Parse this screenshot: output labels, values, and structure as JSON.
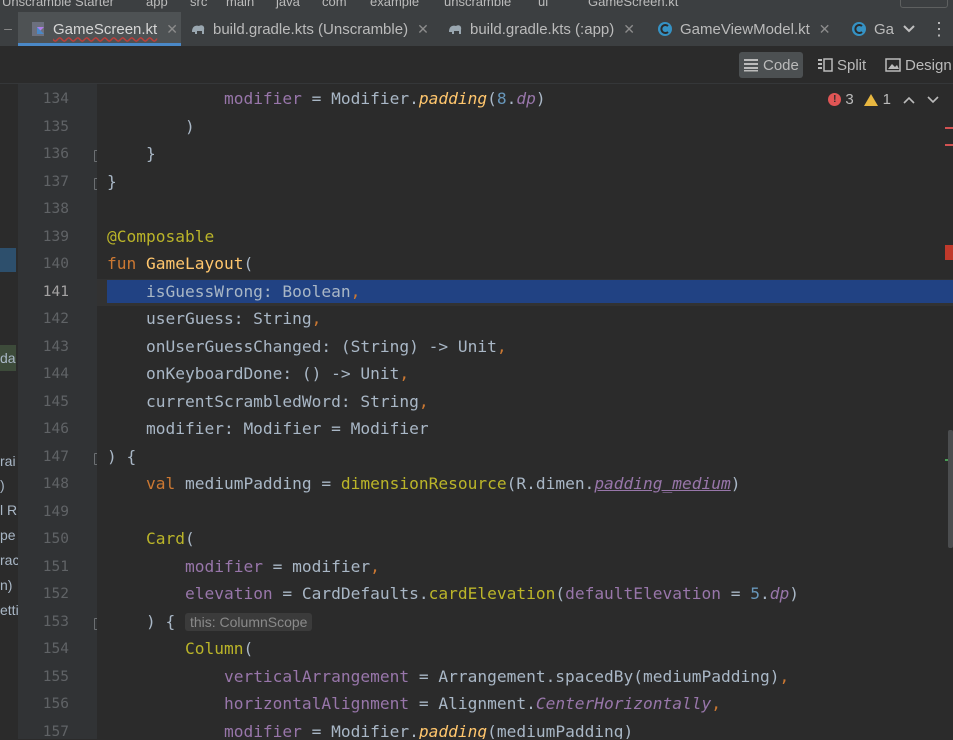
{
  "breadcrumb": [
    "Unscramble Starter",
    "app",
    "src",
    "main",
    "java",
    "com",
    "example",
    "unscramble",
    "ui",
    "GameScreen.kt"
  ],
  "tabs": [
    {
      "label": "GameScreen.kt",
      "icon": "kotlin-file-icon",
      "active": true
    },
    {
      "label": "build.gradle.kts (Unscramble)",
      "icon": "gradle-elephant-icon",
      "active": false
    },
    {
      "label": "build.gradle.kts (:app)",
      "icon": "gradle-elephant-icon",
      "active": false
    },
    {
      "label": "GameViewModel.kt",
      "icon": "kotlin-class-icon",
      "active": false
    },
    {
      "label": "Ga",
      "icon": "kotlin-class-icon",
      "active": false
    }
  ],
  "toolbar": {
    "code_label": "Code",
    "split_label": "Split",
    "design_label": "Design"
  },
  "inspections": {
    "errors": "3",
    "warnings": "1"
  },
  "left_panel_fragments": [
    "da",
    "rai",
    ")",
    "l R",
    "pe",
    "rac",
    "n)",
    "etti"
  ],
  "line_numbers": [
    "134",
    "135",
    "136",
    "137",
    "138",
    "139",
    "140",
    "141",
    "142",
    "143",
    "144",
    "145",
    "146",
    "147",
    "148",
    "149",
    "150",
    "151",
    "152",
    "153",
    "154",
    "155",
    "156",
    "157"
  ],
  "current_line": "141",
  "inlay_hint": "this: ColumnScope",
  "colors": {
    "editor_bg": "#2b2b2b",
    "gutter_bg": "#313335",
    "selection": "#214283",
    "keyword": "#cc7832",
    "function": "#ffc66d",
    "annotation": "#bbb529",
    "property": "#9876aa",
    "number": "#6897bb",
    "text": "#a9b7c6"
  },
  "code_lines": [
    [
      {
        "t": "            "
      },
      {
        "t": "modifier",
        "c": "pr"
      },
      {
        "t": " = Modifier."
      },
      {
        "t": "padding",
        "c": "fn it"
      },
      {
        "t": "("
      },
      {
        "t": "8",
        "c": "nm"
      },
      {
        "t": "."
      },
      {
        "t": "dp",
        "c": "pr it"
      },
      {
        "t": ")"
      }
    ],
    [
      {
        "t": "        )"
      }
    ],
    [
      {
        "t": "    }"
      }
    ],
    [
      {
        "t": "}"
      }
    ],
    [
      {
        "t": ""
      }
    ],
    [
      {
        "t": "@Composable",
        "c": "an"
      }
    ],
    [
      {
        "t": "fun ",
        "c": "kw"
      },
      {
        "t": "GameLayout",
        "c": "fn"
      },
      {
        "t": "("
      }
    ],
    [
      {
        "t": "    isGuessWrong: Boolean"
      },
      {
        "t": ",",
        "c": "kw"
      }
    ],
    [
      {
        "t": "    userGuess: String"
      },
      {
        "t": ",",
        "c": "kw"
      }
    ],
    [
      {
        "t": "    onUserGuessChanged: (String) -> Unit"
      },
      {
        "t": ",",
        "c": "kw"
      }
    ],
    [
      {
        "t": "    onKeyboardDone: () -> Unit"
      },
      {
        "t": ",",
        "c": "kw"
      }
    ],
    [
      {
        "t": "    currentScrambledWord: String"
      },
      {
        "t": ",",
        "c": "kw"
      }
    ],
    [
      {
        "t": "    modifier: Modifier = Modifier"
      }
    ],
    [
      {
        "t": ") {"
      }
    ],
    [
      {
        "t": "    "
      },
      {
        "t": "val ",
        "c": "kw"
      },
      {
        "t": "mediumPadding = "
      },
      {
        "t": "dimensionResource",
        "c": "an"
      },
      {
        "t": "(R.dimen."
      },
      {
        "t": "padding_medium",
        "c": "pr it ul"
      },
      {
        "t": ")"
      }
    ],
    [
      {
        "t": ""
      }
    ],
    [
      {
        "t": "    "
      },
      {
        "t": "Card",
        "c": "an"
      },
      {
        "t": "("
      }
    ],
    [
      {
        "t": "        "
      },
      {
        "t": "modifier",
        "c": "pr"
      },
      {
        "t": " = modifier"
      },
      {
        "t": ",",
        "c": "kw"
      }
    ],
    [
      {
        "t": "        "
      },
      {
        "t": "elevation",
        "c": "pr"
      },
      {
        "t": " = CardDefaults."
      },
      {
        "t": "cardElevation",
        "c": "an"
      },
      {
        "t": "("
      },
      {
        "t": "defaultElevation",
        "c": "pr"
      },
      {
        "t": " = "
      },
      {
        "t": "5",
        "c": "nm"
      },
      {
        "t": "."
      },
      {
        "t": "dp",
        "c": "pr it"
      },
      {
        "t": ")"
      }
    ],
    [
      {
        "t": "    ) { "
      },
      {
        "t": "HINT",
        "c": "hint"
      }
    ],
    [
      {
        "t": "        "
      },
      {
        "t": "Column",
        "c": "an"
      },
      {
        "t": "("
      }
    ],
    [
      {
        "t": "            "
      },
      {
        "t": "verticalArrangement",
        "c": "pr"
      },
      {
        "t": " = Arrangement.spacedBy(mediumPadding)"
      },
      {
        "t": ",",
        "c": "kw"
      }
    ],
    [
      {
        "t": "            "
      },
      {
        "t": "horizontalAlignment",
        "c": "pr"
      },
      {
        "t": " = Alignment."
      },
      {
        "t": "CenterHorizontally",
        "c": "pr it"
      },
      {
        "t": ",",
        "c": "kw"
      }
    ],
    [
      {
        "t": "            "
      },
      {
        "t": "modifier",
        "c": "pr"
      },
      {
        "t": " = Modifier."
      },
      {
        "t": "padding",
        "c": "fn it"
      },
      {
        "t": "(mediumPadding)"
      }
    ]
  ]
}
